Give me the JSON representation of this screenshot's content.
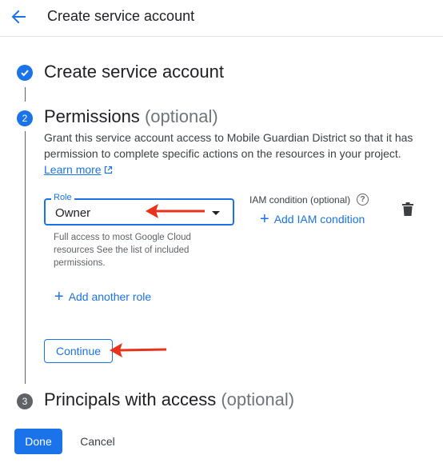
{
  "header": {
    "title": "Create service account",
    "back_icon": "arrow-back-icon"
  },
  "steps": [
    {
      "number": "",
      "title": "Create service account",
      "state": "complete"
    },
    {
      "number": "2",
      "title": "Permissions",
      "optional": "(optional)",
      "state": "active"
    },
    {
      "number": "3",
      "title": "Principals with access",
      "optional": "(optional)",
      "state": "pending"
    }
  ],
  "permissions": {
    "description": "Grant this service account access to Mobile Guardian District so that it has permission to complete specific actions on the resources in your project.",
    "learn_more": "Learn more",
    "role": {
      "label": "Role",
      "value": "Owner",
      "hint": "Full access to most Google Cloud resources See the list of included permissions."
    },
    "iam_condition_label": "IAM condition (optional)",
    "add_iam_condition": "Add IAM condition",
    "add_another_role": "Add another role",
    "continue_label": "Continue"
  },
  "footer": {
    "done_label": "Done",
    "cancel_label": "Cancel"
  },
  "colors": {
    "accent": "#1a73e8",
    "step_pending": "#5f6368",
    "annotation_arrow": "#e8321c"
  }
}
